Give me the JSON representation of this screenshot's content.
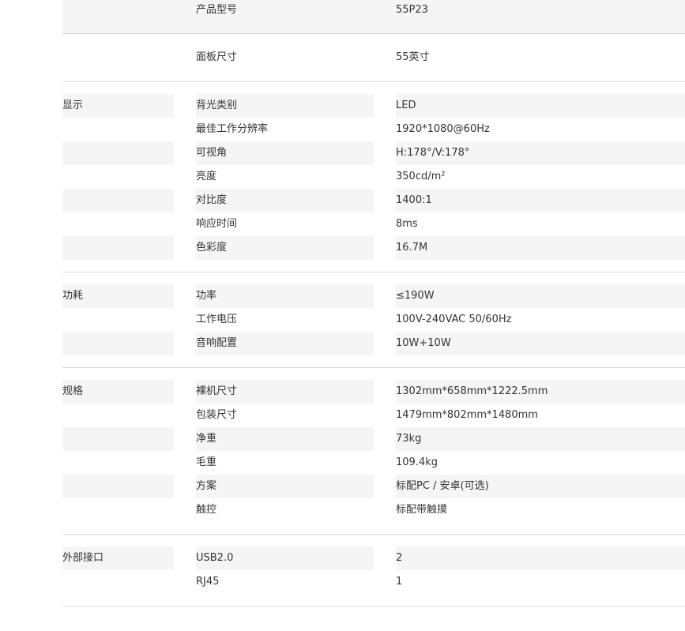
{
  "sections": [
    {
      "category": "",
      "rows": [
        {
          "label": "产品型号",
          "value": "55P23"
        }
      ]
    },
    {
      "category": "",
      "rows": [
        {
          "label": "面板尺寸",
          "value": "55英寸"
        }
      ]
    },
    {
      "category": "显示",
      "rows": [
        {
          "label": "背光类别",
          "value": "LED"
        },
        {
          "label": "最佳工作分辨率",
          "value": "1920*1080@60Hz"
        },
        {
          "label": "可视角",
          "value": "H:178°/V:178°"
        },
        {
          "label": "亮度",
          "value": "350cd/m²"
        },
        {
          "label": "对比度",
          "value": "1400:1"
        },
        {
          "label": "响应时间",
          "value": "8ms"
        },
        {
          "label": "色彩度",
          "value": "16.7M"
        }
      ]
    },
    {
      "category": "功耗",
      "rows": [
        {
          "label": "功率",
          "value": "≤190W"
        },
        {
          "label": "工作电压",
          "value": "100V-240VAC 50/60Hz"
        },
        {
          "label": "音响配置",
          "value": "10W+10W"
        }
      ]
    },
    {
      "category": "规格",
      "rows": [
        {
          "label": "裸机尺寸",
          "value": "1302mm*658mm*1222.5mm"
        },
        {
          "label": "包装尺寸",
          "value": "1479mm*802mm*1480mm"
        },
        {
          "label": "净重",
          "value": "73kg"
        },
        {
          "label": "毛重",
          "value": "109.4kg"
        },
        {
          "label": "方案",
          "value": "标配PC / 安卓(可选)"
        },
        {
          "label": "触控",
          "value": "标配带触摸"
        }
      ]
    },
    {
      "category": "外部接口",
      "rows": [
        {
          "label": "USB2.0",
          "value": "2"
        },
        {
          "label": "RJ45",
          "value": "1"
        }
      ]
    }
  ]
}
